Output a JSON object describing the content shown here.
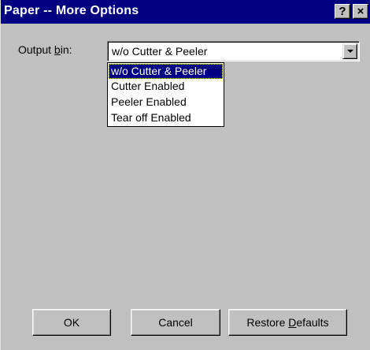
{
  "window": {
    "title": "Paper -- More Options",
    "help_glyph": "?",
    "close_glyph": "×"
  },
  "output_bin": {
    "label_prefix": "Output ",
    "label_accel": "b",
    "label_suffix": "in:",
    "value": "w/o Cutter & Peeler",
    "options": [
      "w/o Cutter & Peeler",
      "Cutter Enabled",
      "Peeler Enabled",
      "Tear off Enabled"
    ],
    "selected_index": 0
  },
  "buttons": {
    "ok": "OK",
    "cancel": "Cancel",
    "restore_prefix": "Restore ",
    "restore_accel": "D",
    "restore_suffix": "efaults"
  },
  "colors": {
    "title_bar": "#000080",
    "dialog_face": "#c0c0c0",
    "highlight": "#000080"
  }
}
